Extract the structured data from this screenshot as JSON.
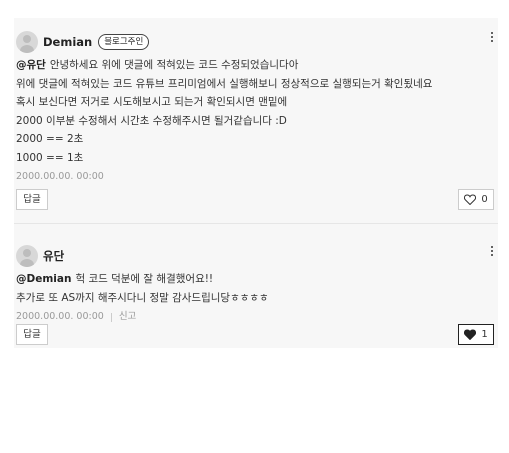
{
  "comments": [
    {
      "author": "Demian",
      "badge": "블로그주인",
      "lines": [
        {
          "mention": "@유단",
          "text": "안녕하세요 위에 댓글에 적혀있는 코드 수정되었습니다아"
        },
        {
          "mention": "",
          "text": "위에 댓글에 적혀있는 코드 유튜브 프리미엄에서 실행해보니 정상적으로 실행되는거 확인됬네요"
        },
        {
          "mention": "",
          "text": "혹시 보신다면 저거로 시도해보시고 되는거 확인되시면 맨밑에"
        },
        {
          "mention": "",
          "text": "2000 이부분 수정해서 시간초 수정해주시면 될거같습니다 :D"
        },
        {
          "mention": "",
          "text": "2000 == 2초"
        },
        {
          "mention": "",
          "text": "1000 == 1초"
        }
      ],
      "date": "2000.00.00. 00:00",
      "reply_label": "답글",
      "like_count": "0",
      "liked": false
    },
    {
      "author": "유단",
      "lines": [
        {
          "mention": "@Demian",
          "text": "헉 코드 덕분에 잘 해결했어요!!"
        },
        {
          "mention": "",
          "text": "추가로 또 AS까지 해주시다니 정말 감사드립니당ㅎㅎㅎㅎ"
        }
      ],
      "date": "2000.00.00. 00:00",
      "report_label": "신고",
      "reply_label": "답글",
      "like_count": "1",
      "liked": true
    }
  ]
}
